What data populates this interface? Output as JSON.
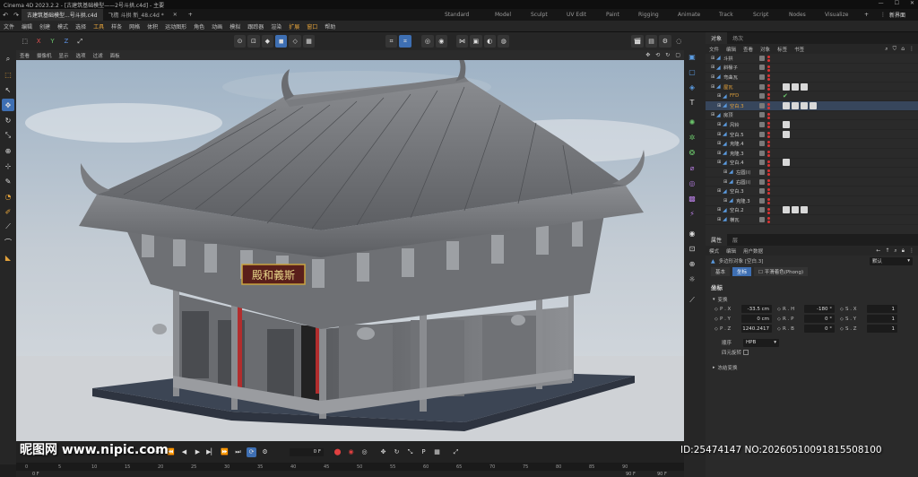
{
  "titlebar": {
    "title": "Cinema 4D 2023.2.2 - [古建筑基础模型——2号斗拱.c4d] - 主要",
    "min_icon": "minimize-icon",
    "max_icon": "maximize-icon",
    "close_icon": "close-icon"
  },
  "tabs": [
    {
      "label": "古建筑基础模型...号斗拱.c4d"
    },
    {
      "label": "飞檐 斗拱 新_48.c4d *"
    }
  ],
  "layouts": [
    "Standard",
    "Model",
    "Sculpt",
    "UV Edit",
    "Paint",
    "Rigging",
    "Animate",
    "Track",
    "Script",
    "Nodes",
    "Visualize"
  ],
  "new_layout": "新界面",
  "menu": [
    "文件",
    "编辑",
    "创建",
    "模式",
    "选择",
    "工具",
    "样条",
    "网格",
    "体积",
    "运动图形",
    "角色",
    "动画",
    "模拟",
    "跟踪器",
    "渲染",
    "扩展",
    "窗口",
    "帮助"
  ],
  "toolbar": {
    "x": "X",
    "y": "Y",
    "z": "Z"
  },
  "viewport_menu": [
    "查看",
    "摄像机",
    "显示",
    "选项",
    "过滤",
    "面板"
  ],
  "timeline": {
    "frame_field": "0 F",
    "ticks": [
      "0",
      "5",
      "10",
      "15",
      "20",
      "25",
      "30",
      "35",
      "40",
      "45",
      "50",
      "55",
      "60",
      "65",
      "70",
      "75",
      "80",
      "85",
      "90"
    ],
    "start": "0 F",
    "end": "90 F",
    "end2": "90 F"
  },
  "objpanel": {
    "tabs": [
      "对象",
      "场次"
    ],
    "menu": [
      "文件",
      "编辑",
      "查看",
      "对象",
      "标签",
      "书签"
    ],
    "rows": [
      {
        "name": "斗拱",
        "indent": 0,
        "color": "#c8c8c8"
      },
      {
        "name": "斜椽子",
        "indent": 0,
        "color": "#c8c8c8"
      },
      {
        "name": "弯曲瓦",
        "indent": 0,
        "color": "#c8c8c8"
      },
      {
        "name": "屋瓦",
        "indent": 0,
        "color": "#e3a23b",
        "tags": 3
      },
      {
        "name": "FFD",
        "indent": 1,
        "color": "#e3a23b",
        "check": "✔"
      },
      {
        "name": "空白.3",
        "indent": 1,
        "color": "#e3a23b",
        "tags": 4
      },
      {
        "name": "房顶",
        "indent": 0,
        "color": "#c8c8c8"
      },
      {
        "name": "风铃",
        "indent": 1,
        "color": "#c8c8c8",
        "tags": 1
      },
      {
        "name": "空白.5",
        "indent": 1,
        "color": "#c8c8c8",
        "tags": 1
      },
      {
        "name": "克隆.4",
        "indent": 1,
        "color": "#c8c8c8"
      },
      {
        "name": "克隆.3",
        "indent": 1,
        "color": "#c8c8c8"
      },
      {
        "name": "空白.4",
        "indent": 1,
        "color": "#c8c8c8",
        "tags": 1
      },
      {
        "name": "左圆川",
        "indent": 2,
        "color": "#c8c8c8"
      },
      {
        "name": "右圆川",
        "indent": 2,
        "color": "#c8c8c8"
      },
      {
        "name": "空白.3",
        "indent": 1,
        "color": "#c8c8c8"
      },
      {
        "name": "克隆.3",
        "indent": 2,
        "color": "#c8c8c8"
      },
      {
        "name": "空白.2",
        "indent": 1,
        "color": "#c8c8c8",
        "tags": 3
      },
      {
        "name": "横瓦",
        "indent": 1,
        "color": "#c8c8c8"
      }
    ]
  },
  "attrpanel": {
    "tabs": [
      "属性",
      "层"
    ],
    "menu": [
      "模式",
      "编辑",
      "用户数据"
    ],
    "object_title": "多边形对象 [空白.3]",
    "mode": "默认",
    "subtabs": [
      "基本",
      "坐标",
      "平滑着色(Phong)"
    ],
    "section": "坐标",
    "subsection": "变换",
    "rows": [
      {
        "p": "P . X",
        "pv": "-33.5 cm",
        "r": "R . H",
        "rv": "-180 °",
        "s": "S . X",
        "sv": "1"
      },
      {
        "p": "P . Y",
        "pv": "0 cm",
        "r": "R . P",
        "rv": "0 °",
        "s": "S . Y",
        "sv": "1"
      },
      {
        "p": "P . Z",
        "pv": "1240.2417",
        "r": "R . B",
        "rv": "0 °",
        "s": "S . Z",
        "sv": "1"
      }
    ],
    "order_label": "顺序",
    "order_value": "HPB",
    "quat_label": "四元旋转",
    "frozen": "冻结变换"
  },
  "scene": {
    "plaque": "殿和義斯"
  },
  "watermark": {
    "left": "昵图网 www.nipic.com",
    "right": "ID:25474147 NO:20260510091815508100"
  }
}
